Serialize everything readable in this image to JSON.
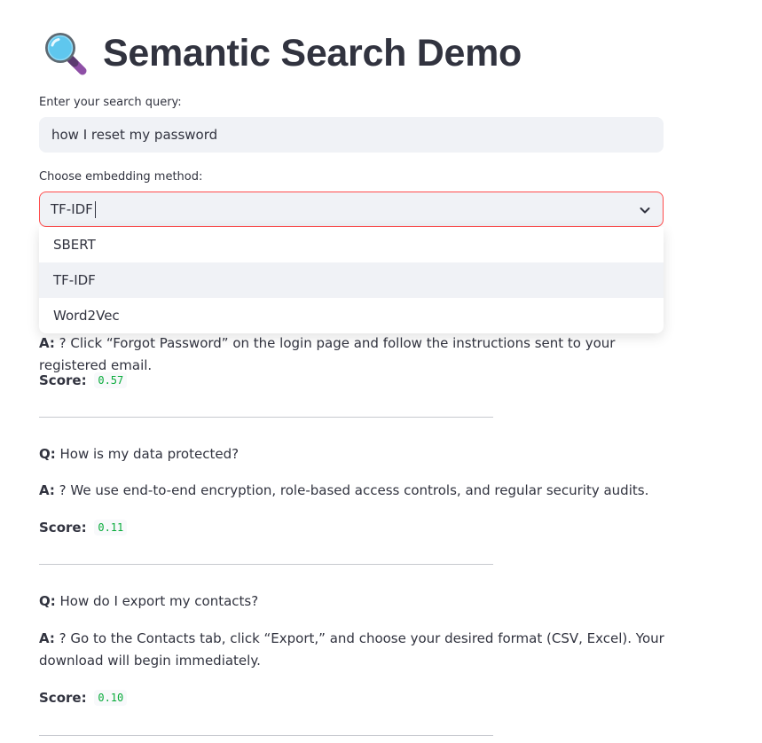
{
  "header": {
    "title": "Semantic Search Demo",
    "icon": "magnifying-glass-icon"
  },
  "search": {
    "label": "Enter your search query:",
    "value": "how I reset my password"
  },
  "embedding": {
    "label": "Choose embedding method:",
    "selected": "TF-IDF",
    "options": [
      "SBERT",
      "TF-IDF",
      "Word2Vec"
    ],
    "highlighted": "TF-IDF"
  },
  "results": [
    {
      "answer_label": "A:",
      "answer": " ? Click “Forgot Password” on the login page and follow the instructions sent to your registered email.",
      "score_label": "Score:",
      "score": "0.57"
    },
    {
      "question_label": "Q:",
      "question": " How is my data protected?",
      "answer_label": "A:",
      "answer": " ? We use end-to-end encryption, role-based access controls, and regular security audits.",
      "score_label": "Score:",
      "score": "0.11"
    },
    {
      "question_label": "Q:",
      "question": " How do I export my contacts?",
      "answer_label": "A:",
      "answer": " ? Go to the Contacts tab, click “Export,” and choose your desired format (CSV, Excel). Your download will begin immediately.",
      "score_label": "Score:",
      "score": "0.10"
    }
  ],
  "colors": {
    "accent": "#ff4b4b",
    "text": "#31333f",
    "input_bg": "#f0f2f6",
    "score_green": "#09ab3b",
    "divider": "#c7c9cf"
  }
}
